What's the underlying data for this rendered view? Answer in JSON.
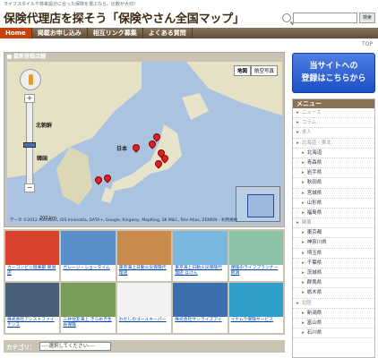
{
  "header": {
    "tagline": "ライフスタイルや将来設計に合った保険を選ぶなら、比較が大切！",
    "title": "保険代理店を探そう「保険やさん全国マップ」",
    "search_button": "検索"
  },
  "nav": {
    "items": [
      "Home",
      "掲載お申し込み",
      "相互リンク募集",
      "よくある質問"
    ]
  },
  "top_link": "TOP",
  "map": {
    "heading": "最新登録店舗",
    "maptype": [
      "地図",
      "航空写真"
    ],
    "labels": {
      "korea": "韓国",
      "japan": "日本",
      "north_korea": "北朝鮮"
    },
    "scale": "200 km",
    "attribution": "データ ©2012 AutoNavi, GIS Innovatia, DATA+, Google, Kingway, MapKing, SK M&C, Tele Atlas, ZENRIN - 利用規約"
  },
  "thumbs": [
    {
      "caption": "カーコンビニ倶楽部 新潟店",
      "color": "#d9432b"
    },
    {
      "caption": "ガレージ・ショータイム",
      "color": "#5b8fc9"
    },
    {
      "caption": "東京海上日動火災保険代理店",
      "color": "#c98a4a"
    },
    {
      "caption": "東京海上日動火災保険代理店 ほけん",
      "color": "#7ab8e0"
    },
    {
      "caption": "保険のライフプランナー 新潟",
      "color": "#8cc4a8"
    },
    {
      "caption": "株式会社アシストファイナンス",
      "color": "#4a5f7a"
    },
    {
      "caption": "三井住友海上 きらめき生命保険",
      "color": "#7a9c5a"
    },
    {
      "caption": "わたしのゴールキーパー",
      "color": "#f2f2f2"
    },
    {
      "caption": "株式会社サンライズアイ",
      "color": "#3d6fb0"
    },
    {
      "caption": "イナムラ保険サービス",
      "color": "#2f9ec9"
    }
  ],
  "category": {
    "label": "カテゴリ：",
    "placeholder": "----選択してください----"
  },
  "cta": {
    "line1": "当サイトへの",
    "line2": "登録はこちらから"
  },
  "menu": {
    "heading": "メニュー",
    "items": [
      {
        "label": "ニュース",
        "kind": "cat"
      },
      {
        "label": "コラム",
        "kind": "cat"
      },
      {
        "label": "求人",
        "kind": "cat"
      },
      {
        "label": "北海道・東北",
        "kind": "cat"
      },
      {
        "label": "北海道",
        "kind": "sub"
      },
      {
        "label": "青森県",
        "kind": "sub"
      },
      {
        "label": "岩手県",
        "kind": "sub"
      },
      {
        "label": "秋田県",
        "kind": "sub"
      },
      {
        "label": "宮城県",
        "kind": "sub"
      },
      {
        "label": "山形県",
        "kind": "sub"
      },
      {
        "label": "福島県",
        "kind": "sub"
      },
      {
        "label": "関東",
        "kind": "cat"
      },
      {
        "label": "東京都",
        "kind": "sub"
      },
      {
        "label": "神奈川県",
        "kind": "sub"
      },
      {
        "label": "埼玉県",
        "kind": "sub"
      },
      {
        "label": "千葉県",
        "kind": "sub"
      },
      {
        "label": "茨城県",
        "kind": "sub"
      },
      {
        "label": "群馬県",
        "kind": "sub"
      },
      {
        "label": "栃木県",
        "kind": "sub"
      },
      {
        "label": "北陸",
        "kind": "cat"
      },
      {
        "label": "新潟県",
        "kind": "sub"
      },
      {
        "label": "富山県",
        "kind": "sub"
      },
      {
        "label": "石川県",
        "kind": "sub"
      }
    ]
  }
}
